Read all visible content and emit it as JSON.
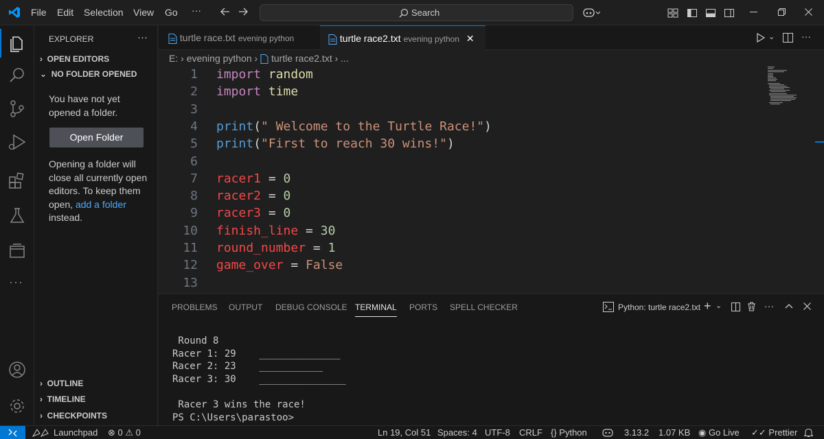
{
  "menu": [
    "File",
    "Edit",
    "Selection",
    "View",
    "Go"
  ],
  "search": {
    "label": "Search"
  },
  "sidebar": {
    "title": "EXPLORER",
    "open_editors": "OPEN EDITORS",
    "no_folder": "NO FOLDER OPENED",
    "message_1": "You have not yet opened a folder.",
    "open_folder_label": "Open Folder",
    "message_2_pre": "Opening a folder will close all currently open editors. To keep them open,",
    "message_2_link": "add a folder",
    "message_2_post": "instead.",
    "outline": "OUTLINE",
    "timeline": "TIMELINE",
    "checkpoints": "CHECKPOINTS"
  },
  "tabs": [
    {
      "name": "turtle race.txt",
      "desc": "evening python",
      "active": false
    },
    {
      "name": "turtle race2.txt",
      "desc": "evening python",
      "active": true
    }
  ],
  "breadcrumb": {
    "drive": "E:",
    "folder": "evening python",
    "file": "turtle race2.txt",
    "more": "..."
  },
  "code": [
    {
      "n": "1",
      "tokens": [
        [
          "kw",
          "import"
        ],
        [
          "op",
          " "
        ],
        [
          "mod",
          "random"
        ]
      ]
    },
    {
      "n": "2",
      "tokens": [
        [
          "kw",
          "import"
        ],
        [
          "op",
          " "
        ],
        [
          "mod",
          "time"
        ]
      ]
    },
    {
      "n": "3",
      "tokens": []
    },
    {
      "n": "4",
      "tokens": [
        [
          "fn",
          "print"
        ],
        [
          "op",
          "("
        ],
        [
          "str",
          "\" Welcome to the Turtle Race!\""
        ],
        [
          "op",
          ")"
        ]
      ]
    },
    {
      "n": "5",
      "tokens": [
        [
          "fn",
          "print"
        ],
        [
          "op",
          "("
        ],
        [
          "str",
          "\"First to reach 30 wins!\""
        ],
        [
          "op",
          ")"
        ]
      ]
    },
    {
      "n": "6",
      "tokens": []
    },
    {
      "n": "7",
      "tokens": [
        [
          "var",
          "racer1"
        ],
        [
          "op",
          " = "
        ],
        [
          "num",
          "0"
        ]
      ]
    },
    {
      "n": "8",
      "tokens": [
        [
          "var",
          "racer2"
        ],
        [
          "op",
          " = "
        ],
        [
          "num",
          "0"
        ]
      ]
    },
    {
      "n": "9",
      "tokens": [
        [
          "var",
          "racer3"
        ],
        [
          "op",
          " = "
        ],
        [
          "num",
          "0"
        ]
      ]
    },
    {
      "n": "10",
      "tokens": [
        [
          "var",
          "finish_line"
        ],
        [
          "op",
          " = "
        ],
        [
          "num",
          "30"
        ]
      ]
    },
    {
      "n": "11",
      "tokens": [
        [
          "var",
          "round_number"
        ],
        [
          "op",
          " = "
        ],
        [
          "num",
          "1"
        ]
      ]
    },
    {
      "n": "12",
      "tokens": [
        [
          "var",
          "game_over"
        ],
        [
          "op",
          " = "
        ],
        [
          "str",
          "False"
        ]
      ]
    },
    {
      "n": "13",
      "tokens": []
    }
  ],
  "panel": {
    "tabs": [
      "PROBLEMS",
      "OUTPUT",
      "DEBUG CONSOLE",
      "TERMINAL",
      "PORTS",
      "SPELL CHECKER"
    ],
    "active_tab": "TERMINAL",
    "terminal_name": "Python: turtle race2.txt",
    "terminal_lines": [
      " Round 8",
      "Racer 1: 29    ______________",
      "Racer 2: 23    ___________",
      "Racer 3: 30    _______________",
      "",
      " Racer 3 wins the race!",
      "PS C:\\Users\\parastoo>"
    ]
  },
  "status": {
    "launchpad": "Launchpad",
    "errors": "0",
    "warnings": "0",
    "position": "Ln 19, Col 51",
    "spaces": "Spaces: 4",
    "encoding": "UTF-8",
    "eol": "CRLF",
    "language": "Python",
    "python_version": "3.13.2",
    "size": "1.07 KB",
    "golive": "Go Live",
    "prettier": "Prettier"
  },
  "colors": {
    "accent": "#0078d4",
    "keyword": "#c586c0",
    "function": "#569cd6",
    "string": "#ce9178",
    "variable": "#f44747",
    "number": "#b5cea8"
  }
}
